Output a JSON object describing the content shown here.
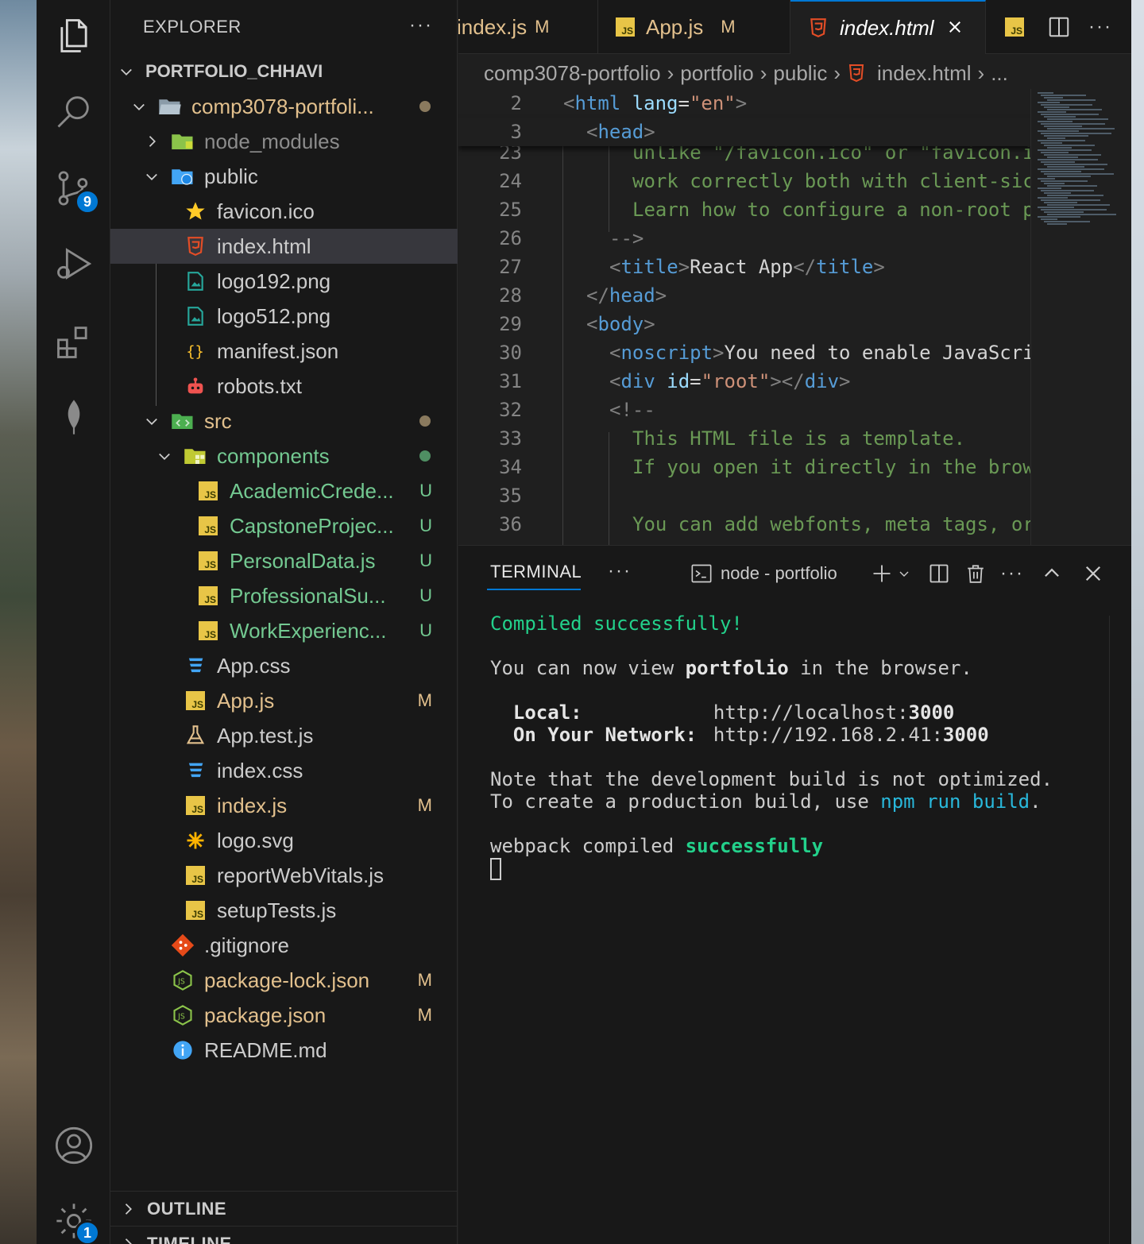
{
  "explorer": {
    "header": "EXPLORER",
    "more": "···",
    "root": "PORTFOLIO_CHHAVI",
    "tree": [
      {
        "name": "comp3078-portfoli...",
        "status": "dot-mod"
      },
      {
        "name": "node_modules",
        "status": ""
      },
      {
        "name": "public",
        "status": ""
      },
      {
        "name": "favicon.ico",
        "status": ""
      },
      {
        "name": "index.html",
        "status": ""
      },
      {
        "name": "logo192.png",
        "status": ""
      },
      {
        "name": "logo512.png",
        "status": ""
      },
      {
        "name": "manifest.json",
        "status": ""
      },
      {
        "name": "robots.txt",
        "status": ""
      },
      {
        "name": "src",
        "status": "dot-mod"
      },
      {
        "name": "components",
        "status": "dot-unt"
      },
      {
        "name": "AcademicCrede...",
        "status": "U"
      },
      {
        "name": "CapstoneProjec...",
        "status": "U"
      },
      {
        "name": "PersonalData.js",
        "status": "U"
      },
      {
        "name": "ProfessionalSu...",
        "status": "U"
      },
      {
        "name": "WorkExperienc...",
        "status": "U"
      },
      {
        "name": "App.css",
        "status": ""
      },
      {
        "name": "App.js",
        "status": "M"
      },
      {
        "name": "App.test.js",
        "status": ""
      },
      {
        "name": "index.css",
        "status": ""
      },
      {
        "name": "index.js",
        "status": "M"
      },
      {
        "name": "logo.svg",
        "status": ""
      },
      {
        "name": "reportWebVitals.js",
        "status": ""
      },
      {
        "name": "setupTests.js",
        "status": ""
      },
      {
        "name": ".gitignore",
        "status": ""
      },
      {
        "name": "package-lock.json",
        "status": "M"
      },
      {
        "name": "package.json",
        "status": "M"
      },
      {
        "name": "README.md",
        "status": ""
      }
    ],
    "outline": "OUTLINE",
    "timeline": "TIMELINE"
  },
  "activity": {
    "source_control_badge": "9",
    "settings_badge": "1",
    "icons": [
      "files-icon",
      "search-icon",
      "source-control-icon",
      "run-debug-icon",
      "extensions-icon",
      "mongodb-leaf-icon",
      "account-icon",
      "settings-gear-icon"
    ]
  },
  "tabs": [
    {
      "label": "index.js",
      "status": "M"
    },
    {
      "label": "App.js",
      "status": "M"
    },
    {
      "label": "index.html",
      "status": ""
    }
  ],
  "breadcrumb": [
    "comp3078-portfolio",
    "portfolio",
    "public",
    "index.html",
    "..."
  ],
  "code": {
    "sticky": [
      {
        "num": "2",
        "text": "<html lang=\"en\">"
      },
      {
        "num": "3",
        "text": "<head>"
      }
    ],
    "partial_line": "unlike \"/favicon.ico\" or \"favicon.i",
    "lines": [
      {
        "num": "23",
        "text": ""
      },
      {
        "num": "24",
        "text": "work correctly both with client-sic"
      },
      {
        "num": "25",
        "text": "Learn how to configure a non-root p"
      },
      {
        "num": "26",
        "text": "-->"
      },
      {
        "num": "27",
        "text": "<title>React App</title>"
      },
      {
        "num": "28",
        "text": "</head>"
      },
      {
        "num": "29",
        "text": "<body>"
      },
      {
        "num": "30",
        "text": "<noscript>You need to enable JavaScri"
      },
      {
        "num": "31",
        "text": "<div id=\"root\"></div>"
      },
      {
        "num": "32",
        "text": "<!--"
      },
      {
        "num": "33",
        "text": "This HTML file is a template."
      },
      {
        "num": "34",
        "text": "If you open it directly in the brow"
      },
      {
        "num": "35",
        "text": ""
      },
      {
        "num": "36",
        "text": "You can add webfonts, meta tags, or"
      }
    ]
  },
  "terminal": {
    "title": "TERMINAL",
    "more": "···",
    "instance": "node - portfolio",
    "output": {
      "compiled": "Compiled successfully!",
      "view_pre": "You can now view ",
      "view_app": "portfolio",
      "view_post": " in the browser.",
      "local_label": "Local:",
      "local_url_pre": "http://localhost:",
      "local_port": "3000",
      "network_label": "On Your Network:",
      "network_url_pre": "http://192.168.2.41:",
      "network_port": "3000",
      "note1": "Note that the development build is not optimized.",
      "note2_pre": "To create a production build, use ",
      "note2_cmd": "npm run build",
      "note2_post": ".",
      "webpack_pre": "webpack compiled ",
      "webpack_ok": "successfully"
    }
  }
}
